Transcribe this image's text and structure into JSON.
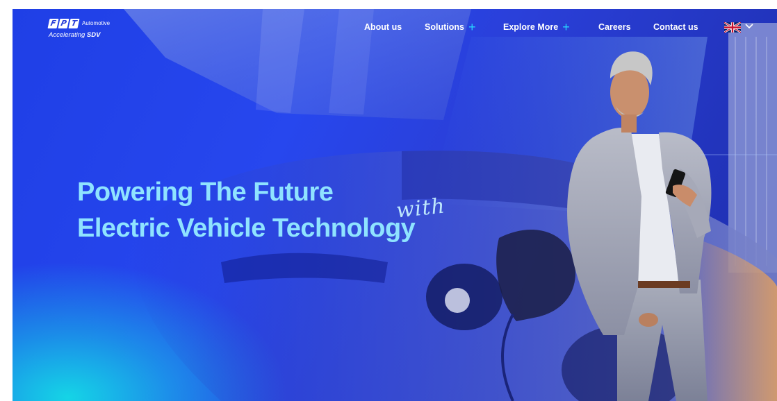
{
  "brand": {
    "logo_letters": [
      "F",
      "P",
      "T"
    ],
    "name": "Automotive",
    "tagline_prefix": "Accelerating",
    "tagline_bold": "SDV"
  },
  "nav": {
    "items": [
      {
        "label": "About us",
        "has_submenu": false
      },
      {
        "label": "Solutions",
        "has_submenu": true,
        "submenu_icon": "plus-icon"
      },
      {
        "label": "Explore More",
        "has_submenu": true,
        "submenu_icon": "plus-icon"
      },
      {
        "label": "Careers",
        "has_submenu": false
      },
      {
        "label": "Contact us",
        "has_submenu": false
      }
    ],
    "plus_glyph": "+",
    "language": {
      "flag_icon": "uk-flag-icon",
      "dropdown_icon": "chevron-down-icon"
    }
  },
  "hero": {
    "headline_line1": "Powering The Future",
    "headline_script": "with",
    "headline_line2": "Electric Vehicle Technology",
    "image_subject": "man in suit holding phone leaning on charging electric car"
  },
  "colors": {
    "hero_blue": "#2747ee",
    "hero_cyan_glow": "#14dce6",
    "headline": "#8fe3ff",
    "nav_text": "#ffffff",
    "accent_plus": "#28d7ff"
  }
}
